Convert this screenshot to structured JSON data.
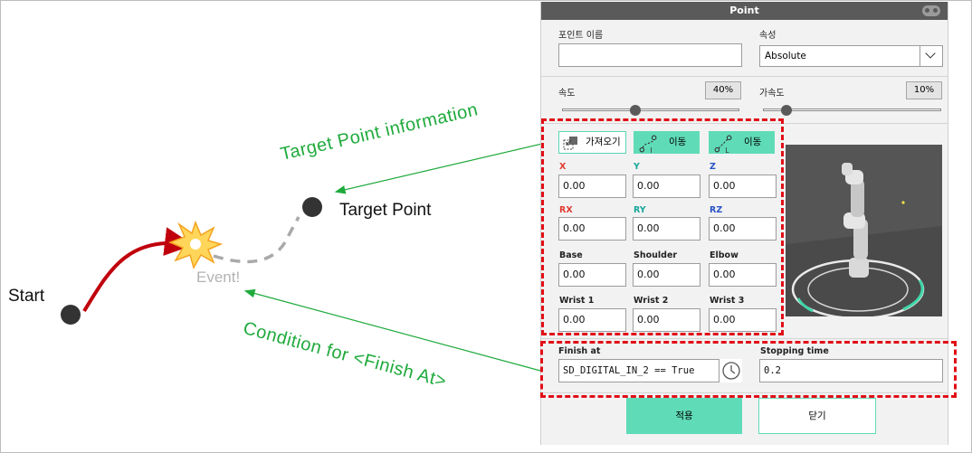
{
  "diagram": {
    "start": "Start",
    "target_point": "Target Point",
    "event": "Event!",
    "target_info_annotation": "Target Point information",
    "condition_annotation": "Condition for <Finish At>"
  },
  "panel": {
    "title": "Point",
    "point_name_label": "포인트 이름",
    "point_name_value": "",
    "attribute_label": "속성",
    "attribute_value": "Absolute",
    "speed_label": "속도",
    "speed_value": "40%",
    "speed_level": 0.4,
    "accel_label": "가속도",
    "accel_value": "10%",
    "accel_level": 0.1,
    "import_button": "가져오기",
    "move_j_button": "이동",
    "move_l_button": "이동",
    "fields": {
      "x_label": "X",
      "x_value": "0.00",
      "y_label": "Y",
      "y_value": "0.00",
      "z_label": "Z",
      "z_value": "0.00",
      "rx_label": "RX",
      "rx_value": "0.00",
      "ry_label": "RY",
      "ry_value": "0.00",
      "rz_label": "RZ",
      "rz_value": "0.00",
      "base_label": "Base",
      "base_value": "0.00",
      "shoulder_label": "Shoulder",
      "shoulder_value": "0.00",
      "elbow_label": "Elbow",
      "elbow_value": "0.00",
      "wrist1_label": "Wrist 1",
      "wrist1_value": "0.00",
      "wrist2_label": "Wrist 2",
      "wrist2_value": "0.00",
      "wrist3_label": "Wrist 3",
      "wrist3_value": "0.00"
    },
    "finish_at_label": "Finish at",
    "finish_at_value": "SD_DIGITAL_IN_2 == True",
    "stopping_time_label": "Stopping time",
    "stopping_time_value": "0.2",
    "apply_button": "적용",
    "close_button": "닫기"
  },
  "colors": {
    "accent": "#5fdcb7",
    "highlight_box": "#e10e17",
    "annotation_green": "#1faa3c",
    "trajectory": "#c0000c"
  },
  "icons": [
    "gamepad-icon",
    "import-icon",
    "move-j-icon",
    "move-l-icon",
    "clock-icon",
    "chevron-down-icon"
  ]
}
